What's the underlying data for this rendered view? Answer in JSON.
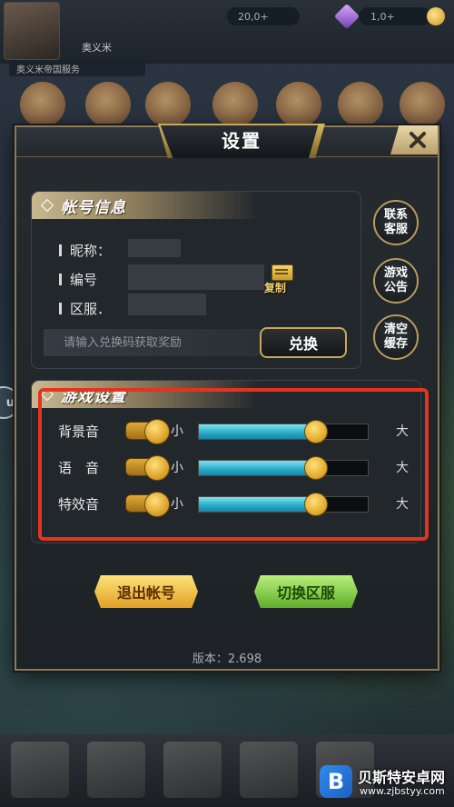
{
  "top_hud": {
    "player_name": "奥义米",
    "resource_1": "20,0+",
    "resource_2": "1,0+",
    "notice": "奥义米帝国服务"
  },
  "dialog": {
    "title": "设置",
    "close_icon": "close-x-icon"
  },
  "account_section": {
    "title": "帐号信息",
    "nickname_label": "昵称：",
    "id_label": "编号",
    "server_label": "区服．",
    "copy_label": "复制",
    "redeem_placeholder": "请输入兑换码获取奖励",
    "redeem_button": "兑换"
  },
  "side_buttons": {
    "support": [
      "联系",
      "客服"
    ],
    "announcement": [
      "游戏",
      "公告"
    ],
    "clear_cache": [
      "清空",
      "缓存"
    ]
  },
  "game_section": {
    "title": "游戏设置",
    "min_label": "小",
    "max_label": "大",
    "rows": [
      {
        "label": "背景音",
        "enabled": true,
        "volume": 0.69
      },
      {
        "label": "语　音",
        "enabled": true,
        "volume": 0.69
      },
      {
        "label": "特效音",
        "enabled": true,
        "volume": 0.69
      }
    ]
  },
  "actions": {
    "logout": "退出帐号",
    "switch_server": "切换区服"
  },
  "version_text": "版本：2.698",
  "side_bubble": "u",
  "watermark": {
    "title": "贝斯特安卓网",
    "url": "www.zjbstyy.com",
    "logo_glyph": "B"
  },
  "colors": {
    "accent_gold": "#c9a858",
    "slider_cyan": "#27a9c6",
    "highlight_red": "#e53320"
  }
}
